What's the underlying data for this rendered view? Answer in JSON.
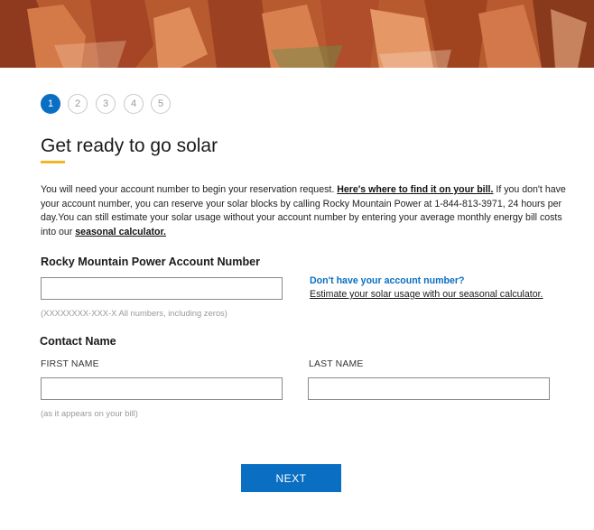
{
  "steps": [
    "1",
    "2",
    "3",
    "4",
    "5"
  ],
  "active_step": 1,
  "page_title": "Get ready to go solar",
  "intro": {
    "part1": "You will need your account number to begin your reservation request. ",
    "link1": "Here's where to find it on your bill.",
    "part2": " If you don't have your account number, you can reserve your solar blocks by calling Rocky Mountain Power at 1-844-813-3971, 24 hours per day.You can still estimate your solar usage without your account number by entering your average monthly energy bill costs into our ",
    "link2": "seasonal calculator."
  },
  "account": {
    "label": "Rocky Mountain Power Account Number",
    "value": "",
    "hint": "(XXXXXXXX-XXX-X All numbers, including zeros)"
  },
  "side": {
    "heading": "Don't have your account number?",
    "link": "Estimate your solar usage with our seasonal calculator."
  },
  "contact": {
    "label": "Contact Name",
    "first_label": "FIRST NAME",
    "first_value": "",
    "last_label": "LAST NAME",
    "last_value": "",
    "hint": "(as it appears on your bill)"
  },
  "next_label": "NEXT",
  "colors": {
    "accent": "#0a6ec3",
    "underline": "#f2b625"
  }
}
